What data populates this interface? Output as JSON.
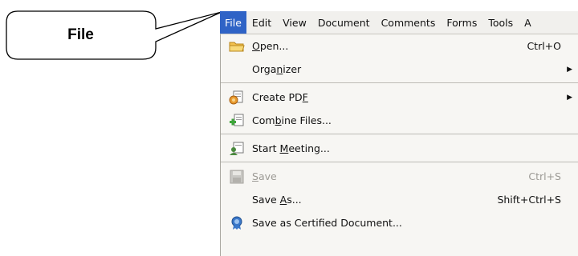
{
  "callout": {
    "label": "File"
  },
  "menubar": {
    "items": [
      "File",
      "Edit",
      "View",
      "Document",
      "Comments",
      "Forms",
      "Tools",
      "A"
    ]
  },
  "file_menu": {
    "items": [
      {
        "pre": "",
        "u": "O",
        "post": "pen...",
        "shortcut": "Ctrl+O",
        "icon": "folder-icon",
        "submenu": false,
        "disabled": false
      },
      {
        "pre": "Orga",
        "u": "n",
        "post": "izer",
        "shortcut": "",
        "icon": "",
        "submenu": true,
        "disabled": false
      },
      {
        "pre": "Create PD",
        "u": "F",
        "post": "",
        "shortcut": "",
        "icon": "create-pdf-icon",
        "submenu": true,
        "disabled": false
      },
      {
        "pre": "Com",
        "u": "b",
        "post": "ine Files...",
        "shortcut": "",
        "icon": "combine-files-icon",
        "submenu": false,
        "disabled": false
      },
      {
        "pre": "Start ",
        "u": "M",
        "post": "eeting...",
        "shortcut": "",
        "icon": "meeting-icon",
        "submenu": false,
        "disabled": false
      },
      {
        "pre": "",
        "u": "S",
        "post": "ave",
        "shortcut": "Ctrl+S",
        "icon": "save-icon",
        "submenu": false,
        "disabled": true
      },
      {
        "pre": "Save ",
        "u": "A",
        "post": "s...",
        "shortcut": "Shift+Ctrl+S",
        "icon": "",
        "submenu": false,
        "disabled": false
      },
      {
        "pre": "Save as Certified Document...",
        "u": "",
        "post": "",
        "shortcut": "",
        "icon": "certified-document-icon",
        "submenu": false,
        "disabled": false
      }
    ]
  },
  "colors": {
    "menubar_bg": "#f1f0ed",
    "active_bg": "#2f63c6",
    "menu_bg": "#f7f6f3",
    "disabled_text": "#9c9a95"
  }
}
